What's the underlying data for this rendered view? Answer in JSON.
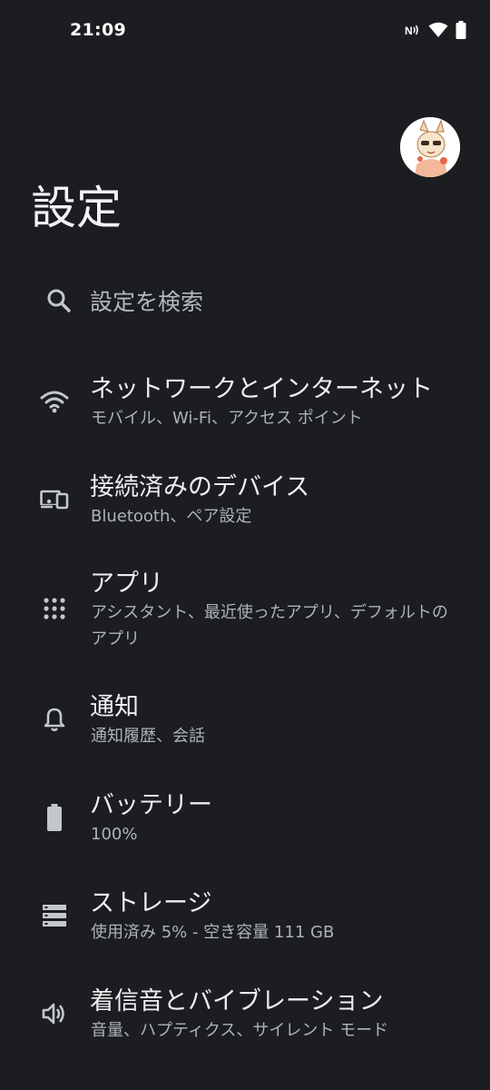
{
  "status_bar": {
    "time": "21:09",
    "icons": [
      "nfc-icon",
      "wifi-icon",
      "battery-icon"
    ]
  },
  "header": {
    "title": "設定",
    "avatar": "avatar"
  },
  "search": {
    "placeholder": "設定を検索",
    "icon": "search-icon"
  },
  "items": [
    {
      "title": "ネットワークとインターネット",
      "subtitle": "モバイル、Wi-Fi、アクセス ポイント",
      "icon": "wifi-icon"
    },
    {
      "title": "接続済みのデバイス",
      "subtitle": "Bluetooth、ペア設定",
      "icon": "devices-icon"
    },
    {
      "title": "アプリ",
      "subtitle": "アシスタント、最近使ったアプリ、デフォルトのアプリ",
      "icon": "apps-grid-icon"
    },
    {
      "title": "通知",
      "subtitle": "通知履歴、会話",
      "icon": "bell-icon"
    },
    {
      "title": "バッテリー",
      "subtitle": "100%",
      "icon": "battery-icon"
    },
    {
      "title": "ストレージ",
      "subtitle": "使用済み 5% - 空き容量 111 GB",
      "icon": "storage-icon"
    },
    {
      "title": "着信音とバイブレーション",
      "subtitle": "音量、ハプティクス、サイレント モード",
      "icon": "volume-icon"
    }
  ],
  "colors": {
    "background": "#1b1d20",
    "title_text": "#eceef0",
    "subtitle_text": "#aeb3b8",
    "icon": "#c4c7cb"
  }
}
